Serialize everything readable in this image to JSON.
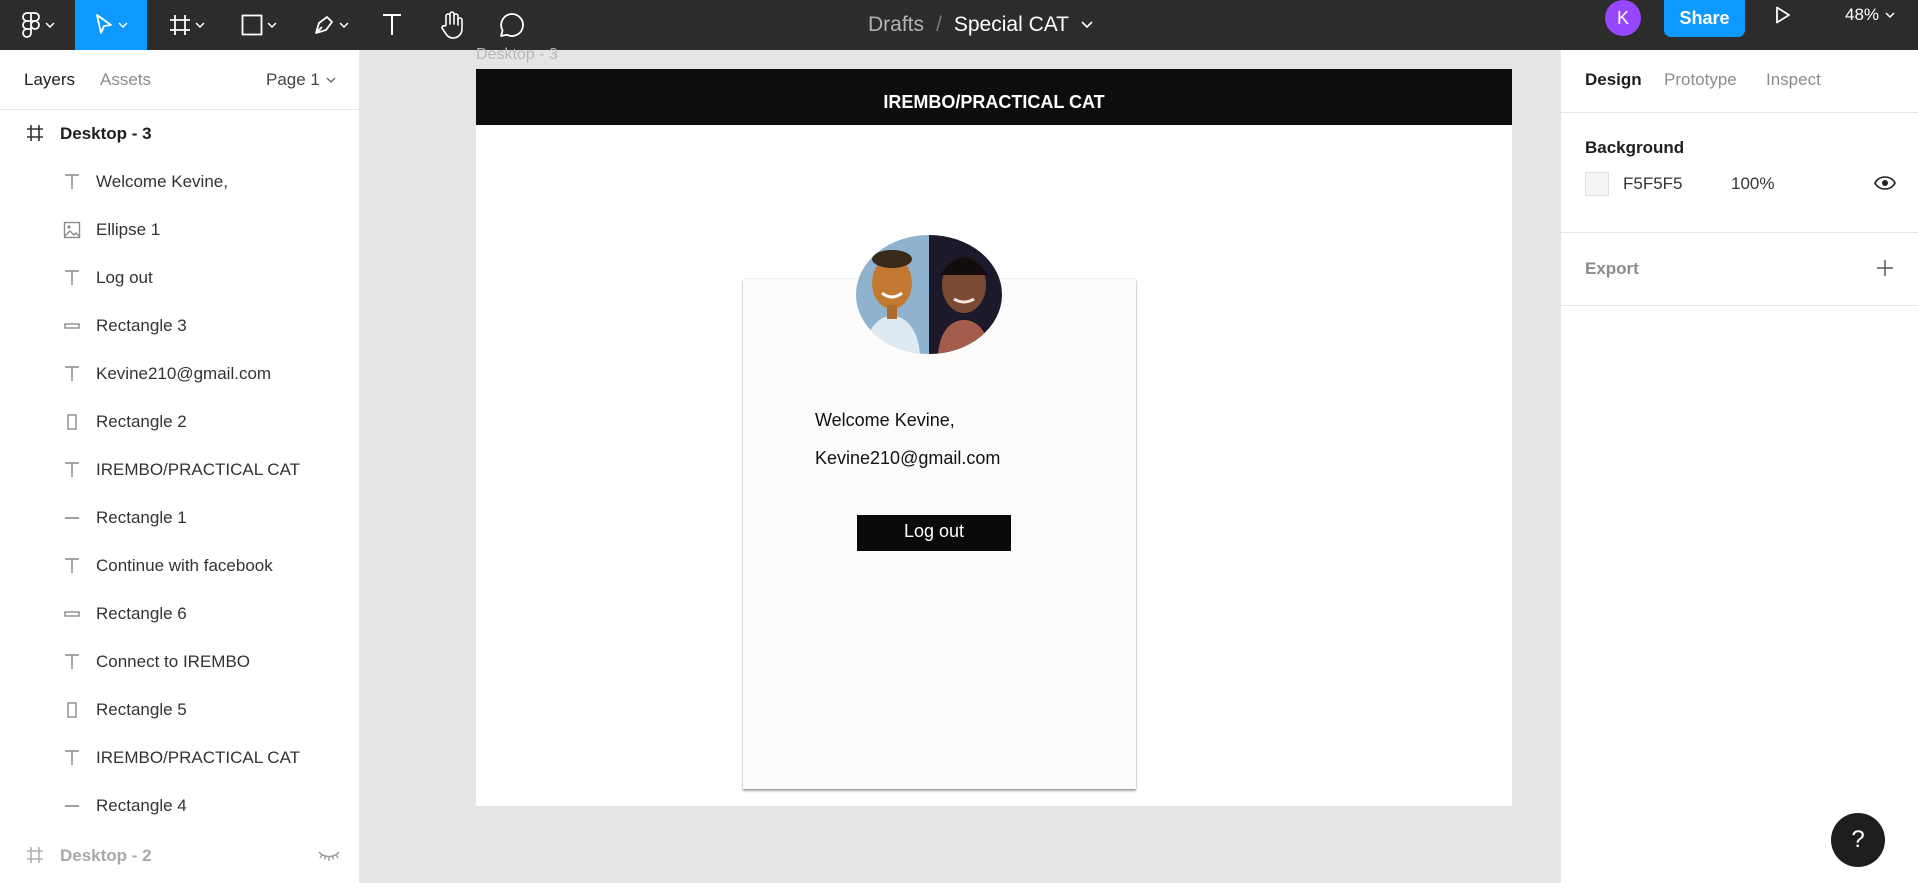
{
  "toolbar": {
    "breadcrumb_drafts": "Drafts",
    "breadcrumb_separator": "/",
    "file_name": "Special CAT",
    "avatar_initial": "K",
    "share_label": "Share",
    "zoom_level": "48%"
  },
  "left_panel": {
    "tab_layers": "Layers",
    "tab_assets": "Assets",
    "page_select": "Page 1",
    "frame_current": "Desktop - 3",
    "frame_other": "Desktop - 2",
    "layers": [
      {
        "label": "Welcome Kevine,",
        "icon": "text-icon"
      },
      {
        "label": "Ellipse 1",
        "icon": "image-icon"
      },
      {
        "label": "Log out",
        "icon": "text-icon"
      },
      {
        "label": "Rectangle 3",
        "icon": "rectangle-wide-icon"
      },
      {
        "label": "Kevine210@gmail.com",
        "icon": "text-icon"
      },
      {
        "label": "Rectangle 2",
        "icon": "rectangle-tall-icon"
      },
      {
        "label": "IREMBO/PRACTICAL CAT",
        "icon": "text-icon"
      },
      {
        "label": "Rectangle 1",
        "icon": "line-icon"
      },
      {
        "label": "Continue with facebook",
        "icon": "text-icon"
      },
      {
        "label": "Rectangle 6",
        "icon": "rectangle-wide-icon"
      },
      {
        "label": "Connect to IREMBO",
        "icon": "text-icon"
      },
      {
        "label": "Rectangle 5",
        "icon": "rectangle-tall-icon"
      },
      {
        "label": "IREMBO/PRACTICAL CAT",
        "icon": "text-icon"
      },
      {
        "label": "Rectangle 4",
        "icon": "line-icon"
      }
    ]
  },
  "canvas": {
    "frame_label": "Desktop - 3",
    "header_title": "IREMBO/PRACTICAL CAT",
    "welcome_text": "Welcome Kevine,",
    "email_text": "Kevine210@gmail.com",
    "logout_label": "Log out"
  },
  "right_panel": {
    "tab_design": "Design",
    "tab_prototype": "Prototype",
    "tab_inspect": "Inspect",
    "background_title": "Background",
    "background_hex": "F5F5F5",
    "background_opacity": "100%",
    "export_title": "Export"
  },
  "help_label": "?",
  "colors": {
    "accent": "#0d99ff",
    "toolbar_bg": "#2c2c2c",
    "avatar": "#9747ff",
    "canvas_bg": "#e5e5e5"
  }
}
